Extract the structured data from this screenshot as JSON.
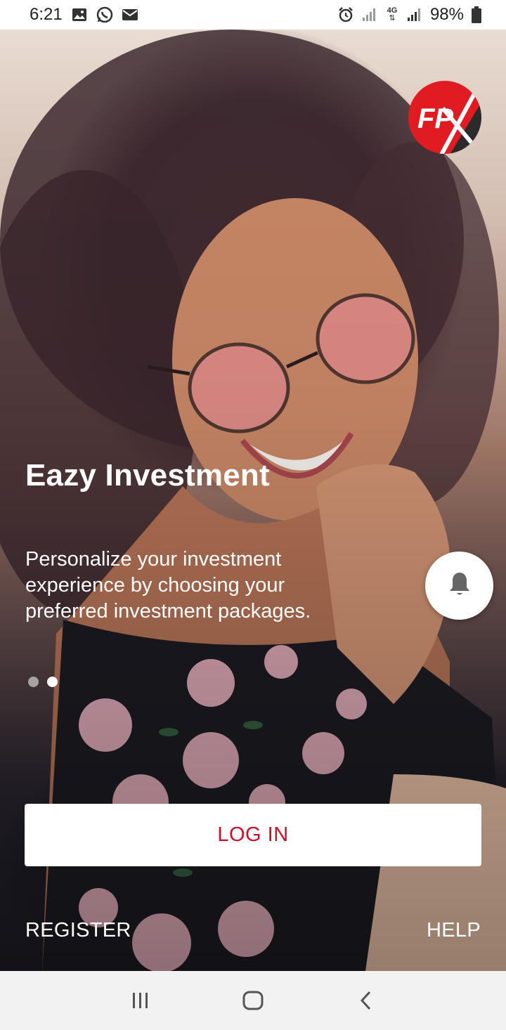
{
  "status_bar": {
    "time": "6:21",
    "left_icons": [
      "gallery-icon",
      "whatsapp-icon",
      "email-icon"
    ],
    "right_icons": [
      "alarm-icon",
      "signal-icon",
      "network-4g-icon",
      "signal-icon",
      "battery-icon"
    ],
    "network_type": "4G",
    "battery": "98%"
  },
  "logo": {
    "text": "FPX",
    "colors": {
      "primary": "#e11b22",
      "secondary": "#2b2b2b"
    }
  },
  "slide": {
    "title": "Eazy Investment",
    "description": "Personalize your investment experience by choosing your preferred investment packages.",
    "page_count": 2,
    "active_page": 2
  },
  "notification_button": {
    "icon": "bell-icon"
  },
  "actions": {
    "login_label": "LOG IN",
    "register_label": "REGISTER",
    "help_label": "HELP"
  },
  "nav_bar": {
    "buttons": [
      "recents-icon",
      "home-icon",
      "back-icon"
    ]
  },
  "colors": {
    "accent": "#c8102e",
    "button_bg": "#ffffff",
    "nav_bg": "#f2f2f2"
  }
}
